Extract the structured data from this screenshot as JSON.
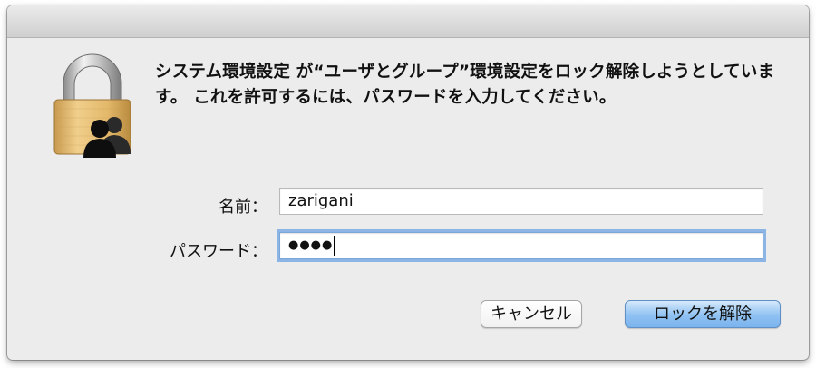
{
  "dialog": {
    "message": "システム環境設定 が“ユーザとグループ”環境設定をロック解除しようとしています。 これを許可するには、パスワードを入力してください。",
    "icon": "lock-with-users-icon"
  },
  "form": {
    "name_label": "名前：",
    "name_value": "zarigani",
    "password_label": "パスワード：",
    "password_masked": "●●●●"
  },
  "buttons": {
    "cancel_label": "キャンセル",
    "unlock_label": "ロックを解除"
  },
  "colors": {
    "window_bg": "#ececec",
    "default_button": "#8fc1f2",
    "focus_ring": "#8cb5e6",
    "lock_gold": "#d9b063"
  }
}
